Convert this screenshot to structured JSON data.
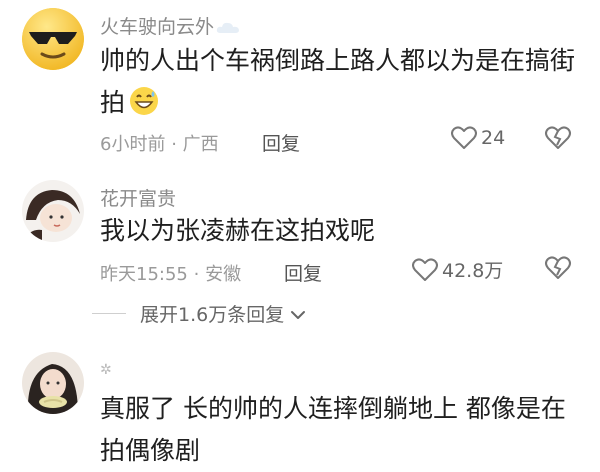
{
  "comments": [
    {
      "username": "火车驶向云外",
      "text_line1": "帅的人出个车祸倒路上路人都以为是在搞街",
      "text_line2": "拍",
      "time": "6小时前",
      "location": "广西",
      "reply_label": "回复",
      "likes": "24"
    },
    {
      "username": "花开富贵",
      "text_line1": "我以为张凌赫在这拍戏呢",
      "time": "昨天15:55",
      "location": "安徽",
      "reply_label": "回复",
      "likes": "42.8万"
    },
    {
      "text_line1": "真服了 长的帅的人连摔倒躺地上 都像是在",
      "text_line2": "拍偶像剧"
    }
  ],
  "separator": "·",
  "expand_replies": {
    "label": "展开1.6万条回复"
  },
  "icons": {
    "like": "heart-outline-icon",
    "dislike": "broken-heart-icon",
    "expand": "chevron-down-icon",
    "emoji": "grinning-sweat-emoji-icon"
  },
  "colors": {
    "username": "#8a8a8a",
    "text": "#1f1f1f",
    "meta": "#9a9a9a"
  }
}
